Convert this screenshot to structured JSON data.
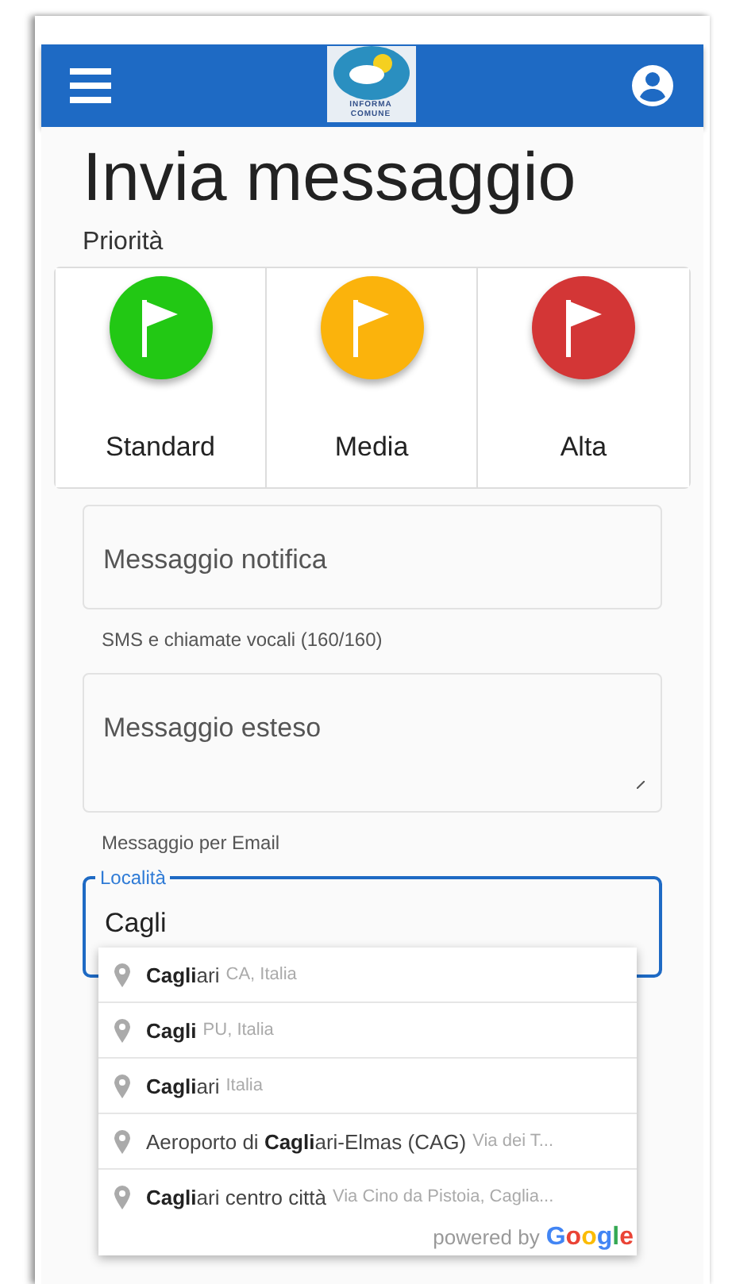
{
  "header": {
    "logo_text": [
      "INFORMA",
      "COMUNE"
    ]
  },
  "title": "Invia messaggio",
  "priority": {
    "label": "Priorità",
    "options": [
      {
        "label": "Standard",
        "color": "#22c814",
        "selected": false
      },
      {
        "label": "Media",
        "color": "#fbb30c",
        "selected": false
      },
      {
        "label": "Alta",
        "color": "#d33636",
        "selected": false
      }
    ]
  },
  "fields": [
    {
      "kind": "input",
      "placeholder": "Messaggio notifica",
      "helper": "SMS e chiamate vocali (160/160)"
    },
    {
      "kind": "textarea",
      "placeholder": "Messaggio esteso",
      "helper": "Messaggio per Email"
    }
  ],
  "location": {
    "label": "Località",
    "value": "Cagli"
  },
  "suggestions": [
    {
      "main": "**Cagli**ari",
      "secondary": "CA, Italia"
    },
    {
      "main": "**Cagli**",
      "secondary": "PU, Italia"
    },
    {
      "main": "**Cagli**ari",
      "secondary": "Italia"
    },
    {
      "main": "Aeroporto di **Cagli**ari-Elmas (CAG)",
      "secondary": "Via dei T..."
    },
    {
      "main": "**Cagli**ari centro città",
      "secondary": "Via Cino da Pistoia, Caglia..."
    }
  ],
  "attribution": {
    "text": "powered by",
    "brand": "Google"
  }
}
